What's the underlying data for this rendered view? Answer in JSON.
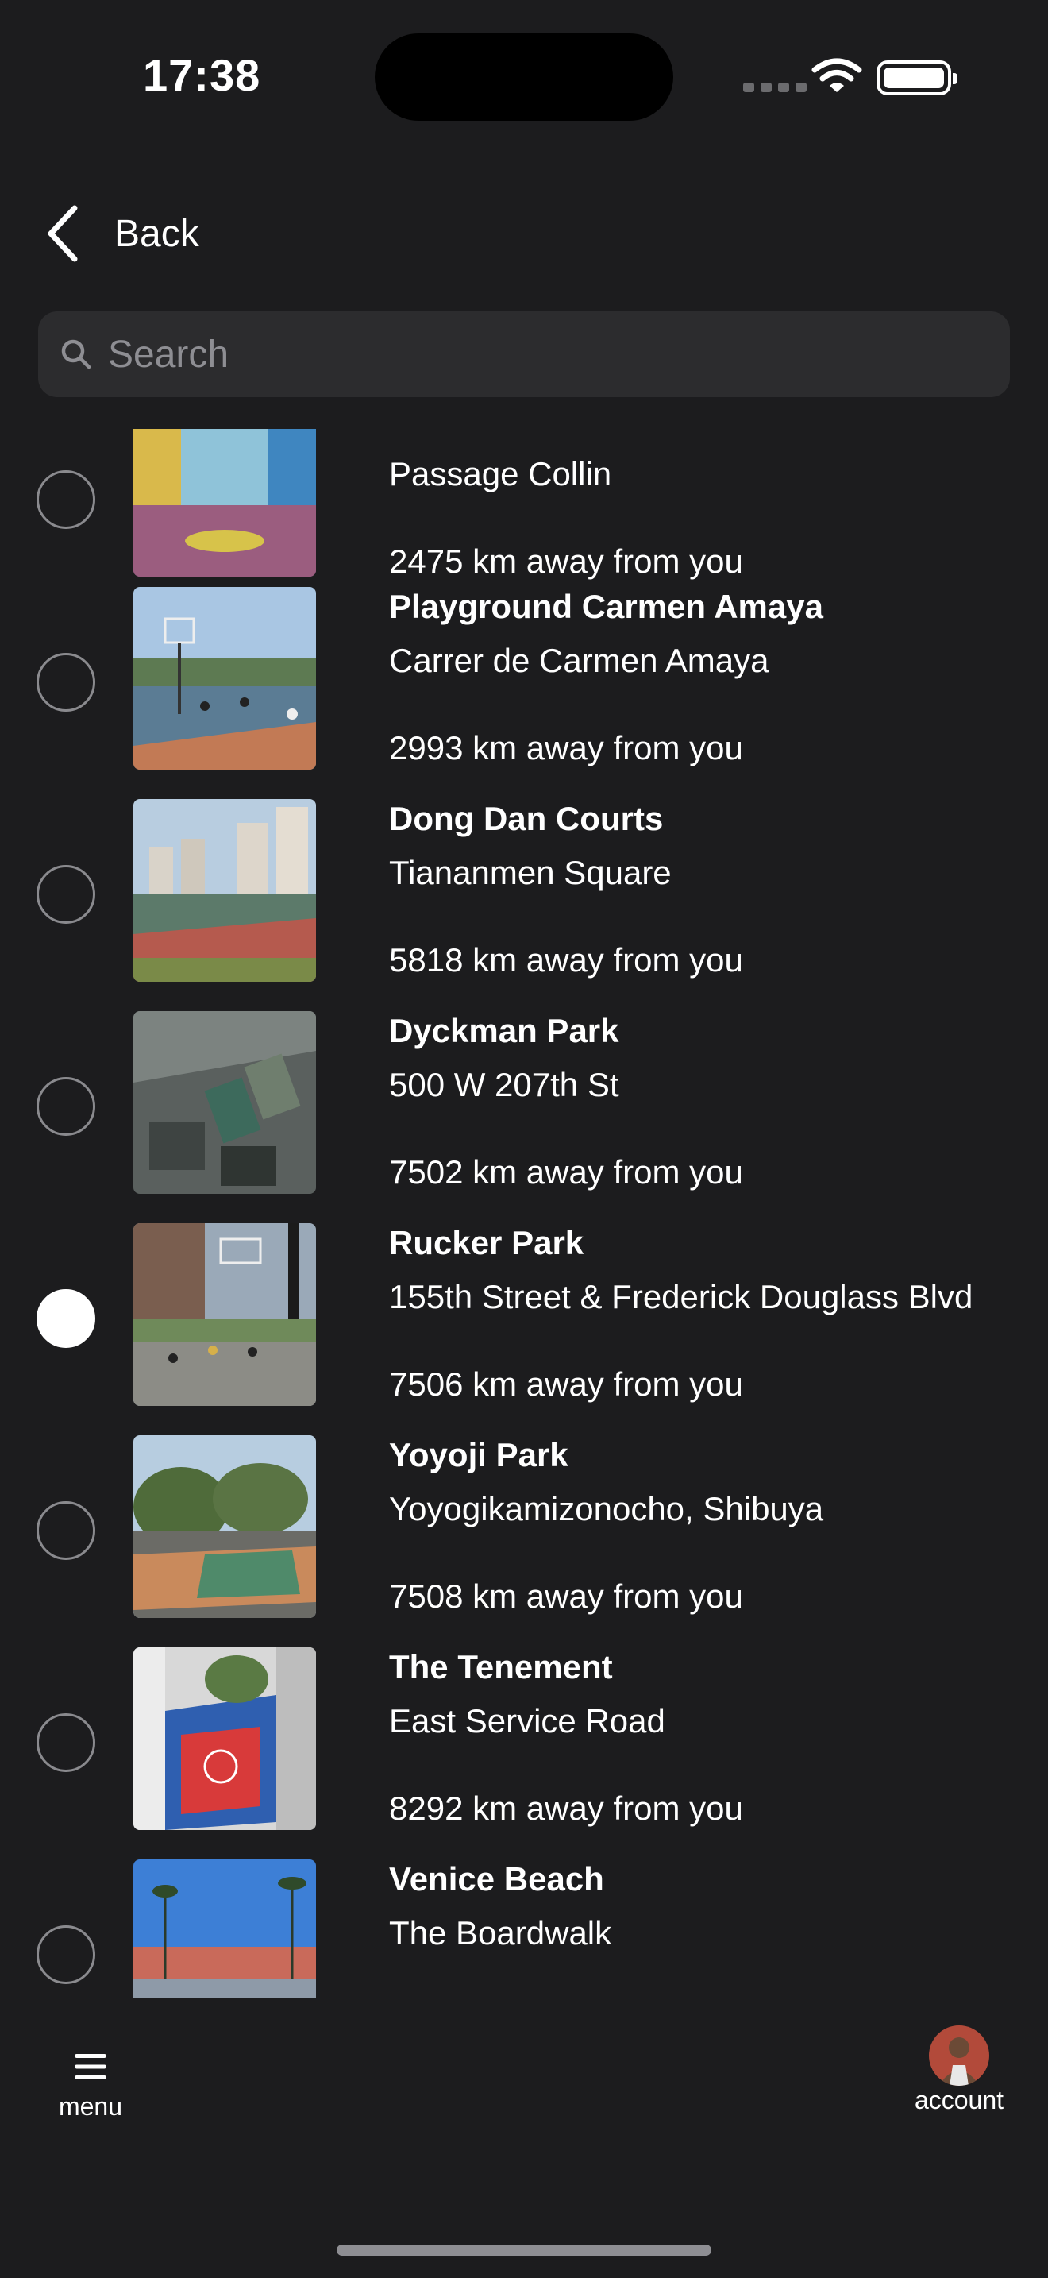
{
  "status_bar": {
    "time": "17:38"
  },
  "nav": {
    "back_label": "Back"
  },
  "search": {
    "placeholder": "Search",
    "value": ""
  },
  "courts": [
    {
      "name": "",
      "address": "Passage Collin",
      "distance": "2475 km away from you",
      "selected": false,
      "thumb_icon": "court-photo"
    },
    {
      "name": "Playground Carmen Amaya",
      "address": "Carrer de Carmen Amaya",
      "distance": "2993 km away from you",
      "selected": false,
      "thumb_icon": "court-photo"
    },
    {
      "name": "Dong Dan Courts",
      "address": "Tiananmen Square",
      "distance": "5818 km away from you",
      "selected": false,
      "thumb_icon": "court-photo"
    },
    {
      "name": "Dyckman Park",
      "address": "500 W 207th St",
      "distance": "7502 km away from you",
      "selected": false,
      "thumb_icon": "aerial-photo"
    },
    {
      "name": "Rucker Park",
      "address": "155th Street & Frederick Douglass Blvd",
      "distance": "7506 km away from you",
      "selected": true,
      "thumb_icon": "court-photo"
    },
    {
      "name": "Yoyoji Park",
      "address": "Yoyogikamizonocho, Shibuya",
      "distance": "7508 km away from you",
      "selected": false,
      "thumb_icon": "court-photo"
    },
    {
      "name": "The Tenement",
      "address": "East Service Road",
      "distance": "8292 km away from you",
      "selected": false,
      "thumb_icon": "court-photo"
    },
    {
      "name": "Venice Beach",
      "address": "The Boardwalk",
      "distance": "",
      "selected": false,
      "thumb_icon": "court-photo"
    }
  ],
  "bottom_bar": {
    "menu_label": "menu",
    "account_label": "account"
  },
  "colors": {
    "background": "#1c1c1e",
    "search_bg": "#2c2c2e",
    "placeholder": "#8e8e93",
    "text": "#ffffff"
  }
}
